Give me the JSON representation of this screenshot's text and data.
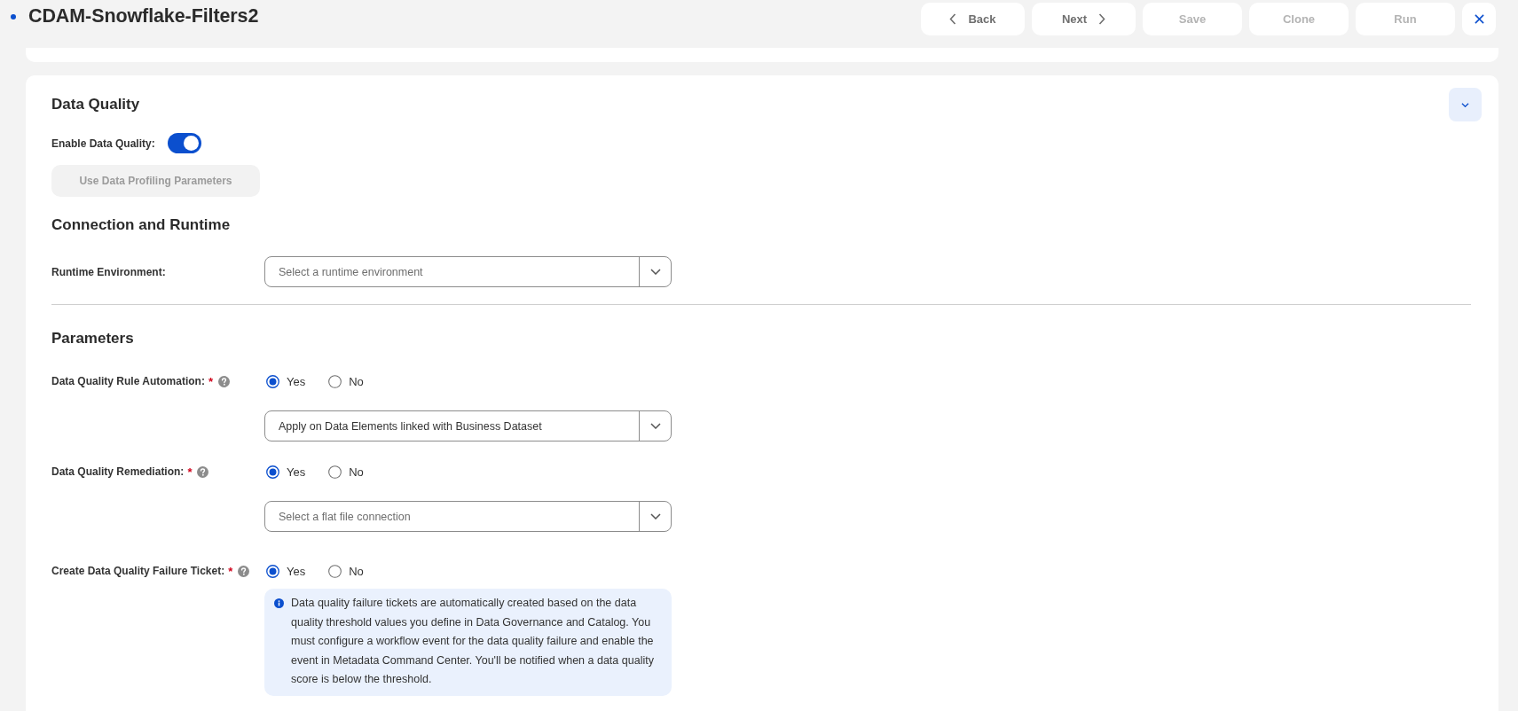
{
  "header": {
    "title": "CDAM-Snowflake-Filters2",
    "modified": true
  },
  "toolbar": [
    {
      "kind": "back",
      "label": "Back",
      "disabled": false
    },
    {
      "kind": "next",
      "label": "Next",
      "disabled": false
    },
    {
      "kind": "plain",
      "label": "Save",
      "disabled": true
    },
    {
      "kind": "plain",
      "label": "Clone",
      "disabled": true
    },
    {
      "kind": "plain",
      "label": "Run",
      "disabled": true
    },
    {
      "kind": "close",
      "disabled": false
    }
  ],
  "data_quality": {
    "title": "Data Quality",
    "enable": {
      "label": "Enable Data Quality:",
      "on": true
    },
    "profiling_button": {
      "label": "Use Data Profiling Parameters",
      "disabled": true
    }
  },
  "connection": {
    "title": "Connection and Runtime",
    "fields": [
      {
        "label": "Runtime Environment:",
        "placeholder": "Select a runtime environment"
      }
    ]
  },
  "parameters": {
    "title": "Parameters",
    "items": [
      {
        "label": "Data Quality Rule Automation:",
        "required_mark": "*",
        "help": true,
        "options": [
          {
            "label": "Yes",
            "selected": true
          },
          {
            "label": "No",
            "selected": false
          }
        ],
        "select": {
          "value": "Apply on Data Elements linked with Business Dataset"
        }
      },
      {
        "label": "Data Quality Remediation:",
        "required_mark": "*",
        "help": true,
        "options": [
          {
            "label": "Yes",
            "selected": true
          },
          {
            "label": "No",
            "selected": false
          }
        ],
        "select": {
          "placeholder": "Select a flat file connection"
        }
      },
      {
        "label": "Create Data Quality Failure Ticket:",
        "required_mark": "*",
        "help": true,
        "options": [
          {
            "label": "Yes",
            "selected": true
          },
          {
            "label": "No",
            "selected": false
          }
        ],
        "note": "Data quality failure tickets are automatically created based on the data quality threshold values you define in Data Governance and Catalog. You must configure a workflow event for the data quality failure and enable the event in Metadata Command Center. You'll be notified when a data quality score is below the threshold."
      }
    ]
  }
}
